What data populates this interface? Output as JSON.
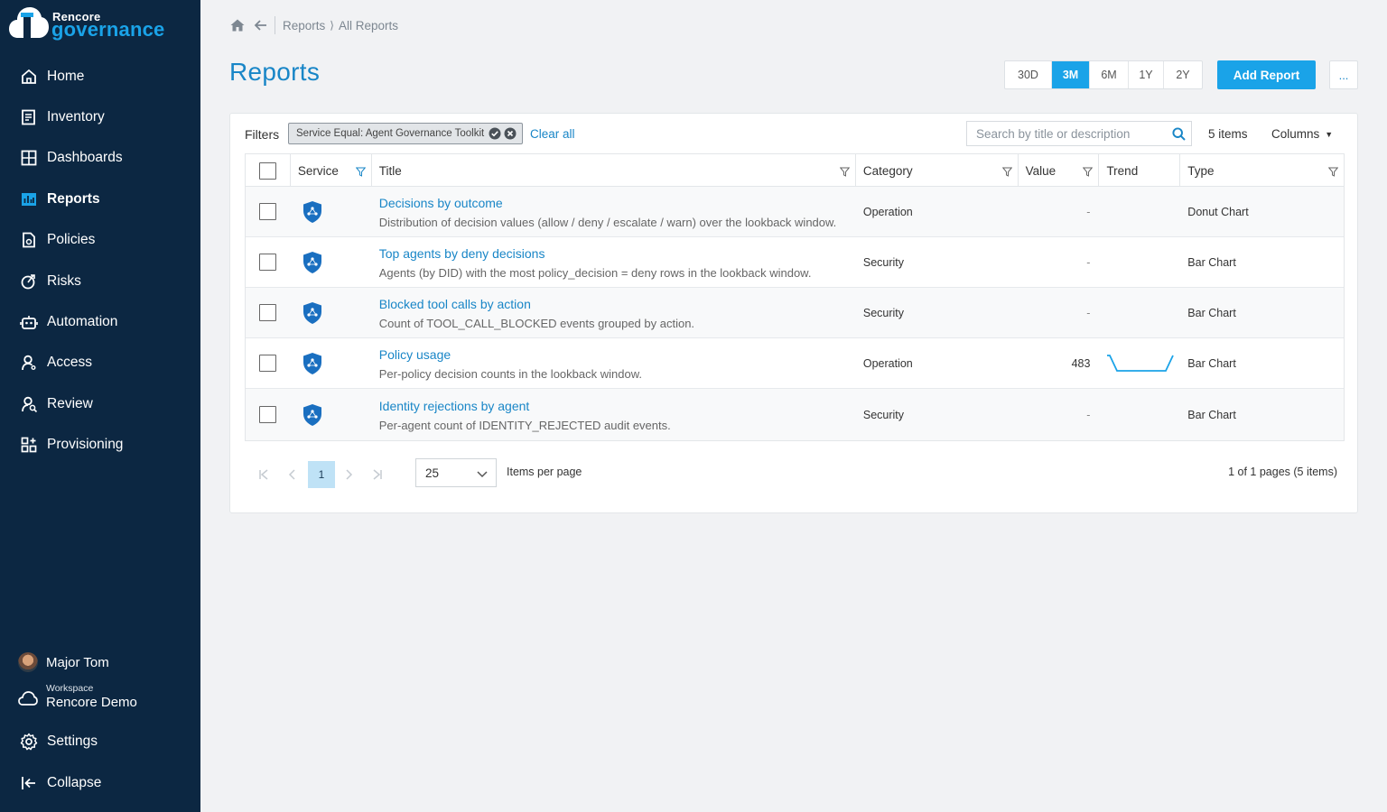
{
  "brand": {
    "line1": "Rencore",
    "line2": "governance"
  },
  "nav": [
    {
      "label": "Home",
      "icon": "home-icon",
      "active": false
    },
    {
      "label": "Inventory",
      "icon": "inventory-icon",
      "active": false
    },
    {
      "label": "Dashboards",
      "icon": "dashboards-icon",
      "active": false
    },
    {
      "label": "Reports",
      "icon": "reports-icon",
      "active": true
    },
    {
      "label": "Policies",
      "icon": "policies-icon",
      "active": false
    },
    {
      "label": "Risks",
      "icon": "risks-icon",
      "active": false
    },
    {
      "label": "Automation",
      "icon": "robot-icon",
      "active": false
    },
    {
      "label": "Access",
      "icon": "access-icon",
      "active": false
    },
    {
      "label": "Review",
      "icon": "review-icon",
      "active": false
    },
    {
      "label": "Provisioning",
      "icon": "provisioning-icon",
      "active": false
    }
  ],
  "user": {
    "name": "Major Tom"
  },
  "workspace": {
    "label": "Workspace",
    "name": "Rencore Demo"
  },
  "settings_label": "Settings",
  "collapse_label": "Collapse",
  "breadcrumb": {
    "items": [
      "Reports",
      "All Reports"
    ],
    "separator": "⟩"
  },
  "page_title": "Reports",
  "ranges": [
    {
      "label": "30D",
      "active": false
    },
    {
      "label": "3M",
      "active": true
    },
    {
      "label": "6M",
      "active": false
    },
    {
      "label": "1Y",
      "active": false
    },
    {
      "label": "2Y",
      "active": false
    }
  ],
  "add_report_label": "Add Report",
  "more_label": "...",
  "filters": {
    "label": "Filters",
    "chip": "Service Equal: Agent Governance Toolkit",
    "clear_all": "Clear all"
  },
  "search": {
    "placeholder": "Search by title or description"
  },
  "items_count": "5 items",
  "columns_label": "Columns",
  "table": {
    "headers": {
      "service": "Service",
      "title": "Title",
      "category": "Category",
      "value": "Value",
      "trend": "Trend",
      "type": "Type"
    },
    "rows": [
      {
        "title": "Decisions by outcome",
        "description": "Distribution of decision values (allow / deny / escalate / warn) over the lookback window.",
        "category": "Operation",
        "value": "-",
        "trend": false,
        "type": "Donut Chart"
      },
      {
        "title": "Top agents by deny decisions",
        "description": "Agents (by DID) with the most policy_decision = deny rows in the lookback window.",
        "category": "Security",
        "value": "-",
        "trend": false,
        "type": "Bar Chart"
      },
      {
        "title": "Blocked tool calls by action",
        "description": "Count of TOOL_CALL_BLOCKED events grouped by action.",
        "category": "Security",
        "value": "-",
        "trend": false,
        "type": "Bar Chart"
      },
      {
        "title": "Policy usage",
        "description": "Per-policy decision counts in the lookback window.",
        "category": "Operation",
        "value": "483",
        "trend": true,
        "type": "Bar Chart"
      },
      {
        "title": "Identity rejections by agent",
        "description": "Per-agent count of IDENTITY_REJECTED audit events.",
        "category": "Security",
        "value": "-",
        "trend": false,
        "type": "Bar Chart"
      }
    ]
  },
  "pager": {
    "page": "1",
    "per_page": "25",
    "per_page_label": "Items per page",
    "info": "1 of 1 pages (5 items)"
  },
  "colors": {
    "sidebar": "#0c2742",
    "accent": "#1aa3e8",
    "link": "#1986c7"
  }
}
